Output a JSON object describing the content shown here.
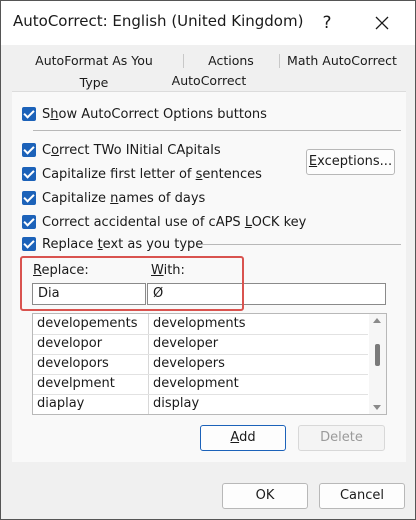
{
  "window": {
    "title": "AutoCorrect: English (United Kingdom)",
    "help_label": "?",
    "close_icon": "close-icon"
  },
  "tabs": {
    "row1": [
      "AutoFormat As You Type",
      "Actions",
      "Math AutoCorrect"
    ],
    "active": "AutoCorrect"
  },
  "options": {
    "show_buttons": {
      "label_pre": "S",
      "label_u": "h",
      "label_post": "ow AutoCorrect Options buttons",
      "checked": true
    },
    "two_initial": {
      "label_pre": "C",
      "label_u": "o",
      "label_post": "rrect TWo INitial CApitals",
      "checked": true
    },
    "capitalize_sentences": {
      "label_pre": "Capitalize first letter of ",
      "label_u": "s",
      "label_post": "entences",
      "checked": true
    },
    "capitalize_days": {
      "label_pre": "Capitalize ",
      "label_u": "n",
      "label_post": "ames of days",
      "checked": true
    },
    "caps_lock": {
      "label_pre": "Correct accidental use of cAPS ",
      "label_u": "L",
      "label_post": "OCK key",
      "checked": true
    },
    "replace_text": {
      "label_pre": "Replace ",
      "label_u": "t",
      "label_post": "ext as you type",
      "checked": true
    }
  },
  "exceptions_button": {
    "label_u": "E",
    "label_post": "xceptions..."
  },
  "replace": {
    "replace_label_u": "R",
    "replace_label_post": "eplace:",
    "with_label_u": "W",
    "with_label_post": "ith:",
    "replace_value": "Dia",
    "with_value": "Ø"
  },
  "entries": [
    {
      "replace": "developements",
      "with": "developments"
    },
    {
      "replace": "developor",
      "with": "developer"
    },
    {
      "replace": "developors",
      "with": "developers"
    },
    {
      "replace": "develpment",
      "with": "development"
    },
    {
      "replace": "diaplay",
      "with": "display"
    }
  ],
  "actions": {
    "add_u": "A",
    "add_post": "dd",
    "delete_label": "Delete"
  },
  "footer": {
    "ok_label": "OK",
    "cancel_label": "Cancel"
  },
  "colors": {
    "checkbox": "#1c62b9",
    "highlight_box": "#d9534f"
  }
}
